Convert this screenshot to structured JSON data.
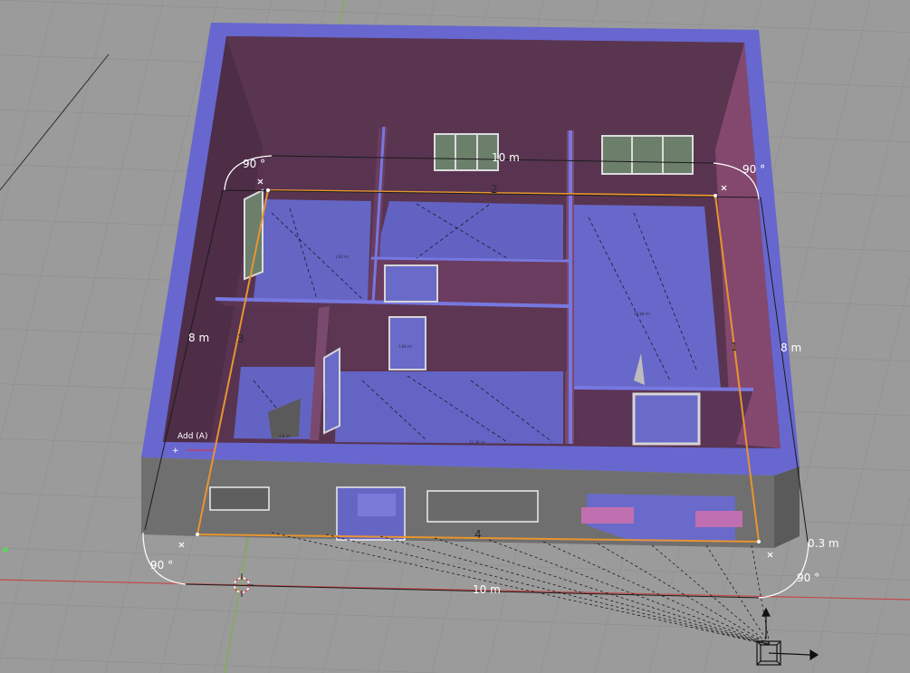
{
  "viewport": {
    "background": "#9b9b9b",
    "grid_color": "#888888",
    "x_axis_color": "#c24a4a",
    "y_axis_color": "#7cb33a"
  },
  "colors": {
    "wall_top": "#6b6bd1",
    "wall_interior": "#5a3550",
    "wall_interior_light": "#8a4a70",
    "floor": "#6a6ac8",
    "exterior_wall": "#6e6e6e",
    "selection": "#e8952f",
    "dimension": "#ffffff"
  },
  "dimensions": {
    "top_width": "10 m",
    "bottom_width": "10 m",
    "left_depth": "8 m",
    "right_depth": "8 m",
    "angle_top_left": "90 °",
    "angle_top_right": "90 °",
    "angle_bottom_left": "90 °",
    "angle_bottom_right": "90 °",
    "thickness": "0.3 m"
  },
  "edge_indices": [
    "1",
    "2",
    "3",
    "4"
  ],
  "room_area_labels": [
    "1.92 m²",
    "1.84 m²",
    "4.8 m²",
    "21.36 m²",
    "15.84 m²"
  ],
  "tool": {
    "label": "Add (A)",
    "icon": "plus-icon"
  },
  "icons": {
    "cursor": "3d-cursor-icon",
    "camera": "camera-icon"
  }
}
